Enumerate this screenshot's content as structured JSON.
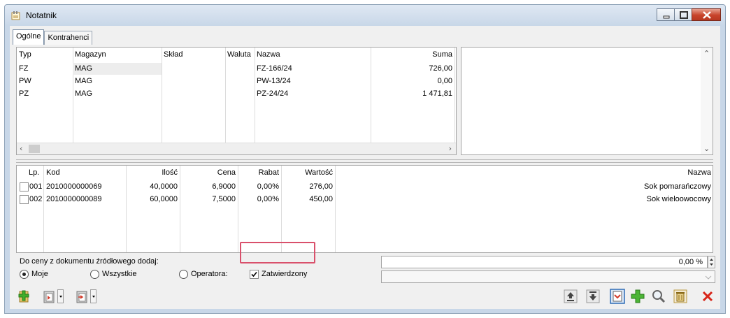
{
  "window": {
    "title": "Notatnik"
  },
  "tabs": [
    {
      "label": "Ogólne"
    },
    {
      "label": "Kontrahenci"
    }
  ],
  "documents": {
    "columns": {
      "typ": "Typ",
      "magazyn": "Magazyn",
      "sklad": "Skład",
      "waluta": "Waluta",
      "nazwa": "Nazwa",
      "suma": "Suma"
    },
    "rows": [
      {
        "typ": "FZ",
        "magazyn": "MAG",
        "sklad": "",
        "waluta": "",
        "nazwa": "FZ-166/24",
        "suma": "726,00"
      },
      {
        "typ": "PW",
        "magazyn": "MAG",
        "sklad": "",
        "waluta": "",
        "nazwa": "PW-13/24",
        "suma": "0,00"
      },
      {
        "typ": "PZ",
        "magazyn": "MAG",
        "sklad": "",
        "waluta": "",
        "nazwa": "PZ-24/24",
        "suma": "1 471,81"
      }
    ]
  },
  "items": {
    "columns": {
      "lp": "Lp.",
      "kod": "Kod",
      "ilosc": "Ilość",
      "cena": "Cena",
      "rabat": "Rabat",
      "wartosc": "Wartość",
      "nazwa": "Nazwa"
    },
    "rows": [
      {
        "lp": "001",
        "kod": "2010000000069",
        "ilosc": "40,0000",
        "cena": "6,9000",
        "rabat": "0,00%",
        "wartosc": "276,00",
        "nazwa": "Sok pomarańczowy"
      },
      {
        "lp": "002",
        "kod": "2010000000089",
        "ilosc": "60,0000",
        "cena": "7,5000",
        "rabat": "0,00%",
        "wartosc": "450,00",
        "nazwa": "Sok wieloowocowy"
      }
    ]
  },
  "options": {
    "heading": "Do ceny z dokumentu źródłowego dodaj:",
    "radio_moje": "Moje",
    "radio_wszystkie": "Wszystkie",
    "radio_operatora": "Operatora:",
    "checkbox_zatwierdzony": "Zatwierdzony",
    "percent_value": "0,00 %"
  },
  "colors": {
    "highlight": "#d9506b",
    "accent": "#2d6bb5"
  }
}
